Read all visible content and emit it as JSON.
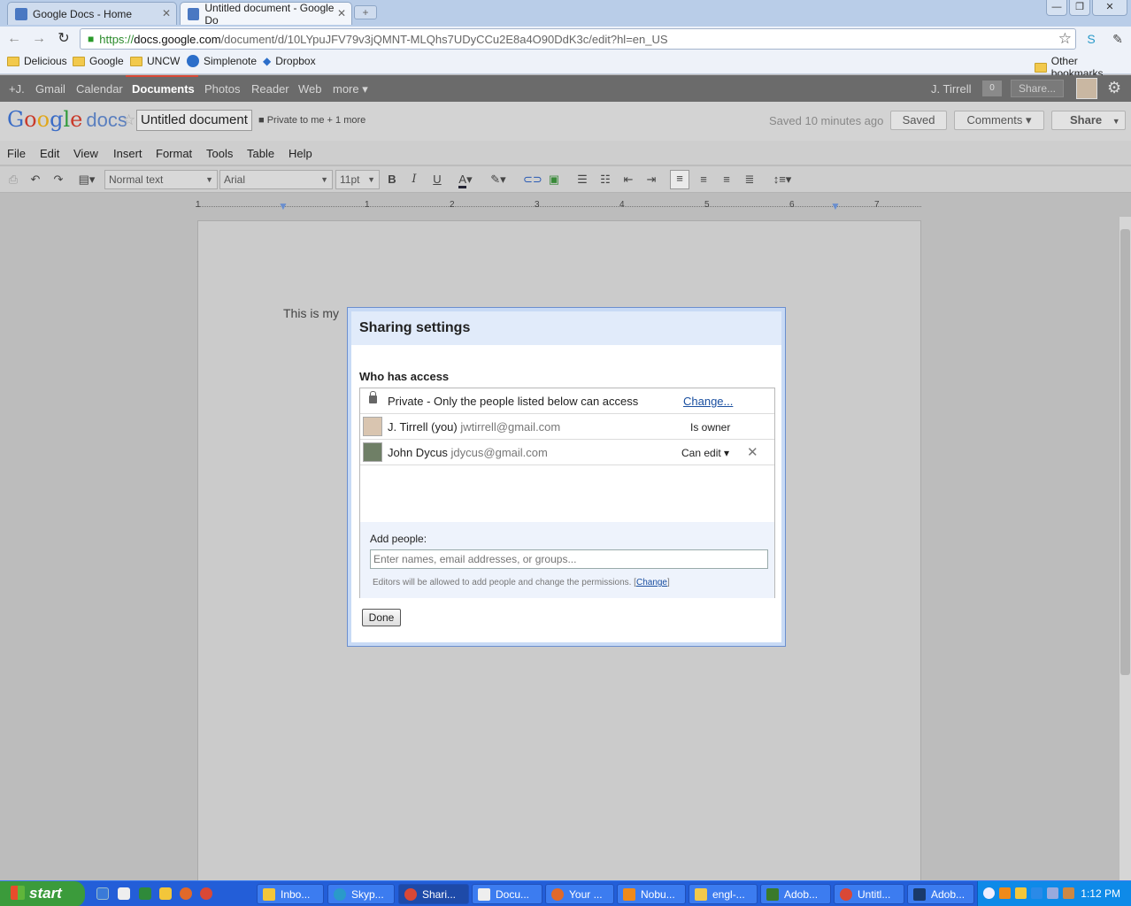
{
  "browser": {
    "tabs": [
      {
        "title": "Google Docs - Home",
        "active": false
      },
      {
        "title": "Untitled document - Google Do",
        "active": true
      }
    ],
    "url_scheme": "https://",
    "url_host": "docs.google.com",
    "url_path": "/document/d/10LYpuJFV79v3jQMNT-MLQhs7UDyCCu2E8a4O90DdK3c/edit?hl=en_US",
    "bookmarks": [
      "Delicious",
      "Google",
      "UNCW",
      "Simplenote",
      "Dropbox"
    ],
    "other_bookmarks": "Other bookmarks"
  },
  "gbar": {
    "items": [
      "+J.",
      "Gmail",
      "Calendar",
      "Documents",
      "Photos",
      "Reader",
      "Web",
      "more ▾"
    ],
    "user": "J. Tirrell",
    "count": "0",
    "share": "Share..."
  },
  "doc": {
    "logo_text": "docs",
    "title": "Untitled document",
    "privacy": "Private to me + 1 more",
    "saved_msg": "Saved 10 minutes ago",
    "saved_btn": "Saved",
    "comments_btn": "Comments ▾",
    "share_btn": "Share",
    "body_text": "This is my"
  },
  "menu": [
    "File",
    "Edit",
    "View",
    "Insert",
    "Format",
    "Tools",
    "Table",
    "Help"
  ],
  "format": {
    "style": "Normal text",
    "font": "Arial",
    "size": "11pt"
  },
  "ruler": [
    "1",
    "1",
    "2",
    "3",
    "4",
    "5",
    "6",
    "7"
  ],
  "dialog": {
    "title": "Sharing settings",
    "who_has_access": "Who has access",
    "private_text": "Private - Only the people listed below can access",
    "change_link": "Change...",
    "people": [
      {
        "name": "J. Tirrell (you)",
        "email": "jwtirrell@gmail.com",
        "role": "Is owner"
      },
      {
        "name": "John Dycus",
        "email": "jdycus@gmail.com",
        "role": "Can edit ▾"
      }
    ],
    "add_people_label": "Add people:",
    "add_people_placeholder": "Enter names, email addresses, or groups...",
    "editors_note": "Editors will be allowed to add people and change the permissions.",
    "note_change": "Change",
    "done": "Done"
  },
  "taskbar": {
    "start": "start",
    "tasks": [
      "Inbo...",
      "Skyp...",
      "Shari...",
      "Docu...",
      "Your ...",
      "Nobu...",
      "engl-...",
      "Adob...",
      "Untitl...",
      "Adob..."
    ],
    "clock": "1:12 PM"
  }
}
